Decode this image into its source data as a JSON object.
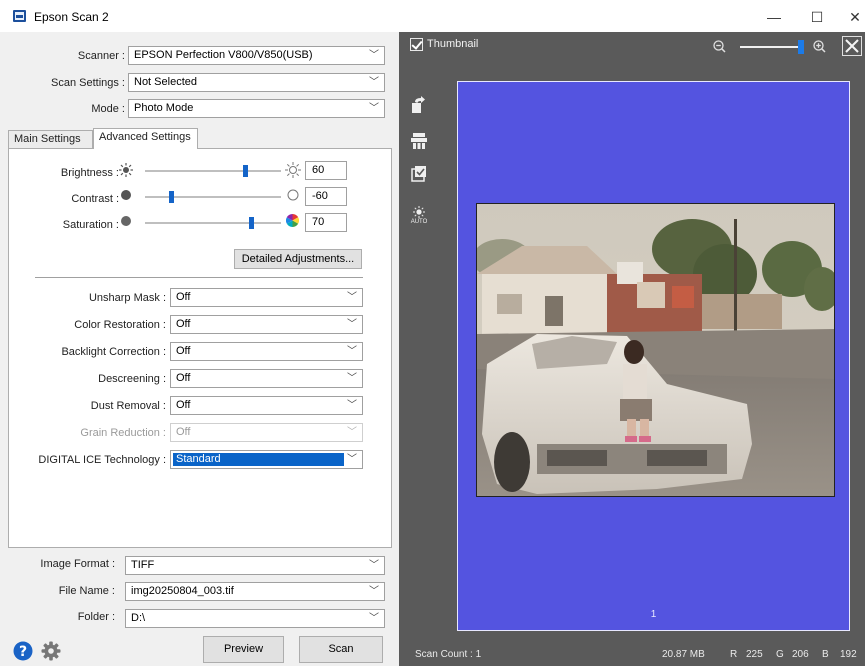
{
  "window": {
    "title": "Epson Scan 2",
    "minimize": "—",
    "maximize": "☐",
    "close": "✕"
  },
  "scanner": {
    "label": "Scanner :",
    "value": "EPSON Perfection V800/V850(USB)"
  },
  "scan_settings": {
    "label": "Scan Settings :",
    "value": "Not Selected"
  },
  "mode": {
    "label": "Mode :",
    "value": "Photo Mode"
  },
  "tabs": [
    {
      "label": "Main Settings"
    },
    {
      "label": "Advanced Settings"
    }
  ],
  "adjustments": {
    "brightness": {
      "label": "Brightness :",
      "value": "60"
    },
    "contrast": {
      "label": "Contrast :",
      "value": "-60"
    },
    "saturation": {
      "label": "Saturation :",
      "value": "70"
    },
    "detailed_button": "Detailed Adjustments..."
  },
  "advanced": {
    "unsharp_mask": {
      "label": "Unsharp Mask :",
      "value": "Off"
    },
    "color_restoration": {
      "label": "Color Restoration :",
      "value": "Off"
    },
    "backlight_correction": {
      "label": "Backlight Correction :",
      "value": "Off"
    },
    "descreening": {
      "label": "Descreening :",
      "value": "Off"
    },
    "dust_removal": {
      "label": "Dust Removal :",
      "value": "Off"
    },
    "grain_reduction": {
      "label": "Grain Reduction :",
      "value": "Off"
    },
    "digital_ice": {
      "label": "DIGITAL ICE Technology :",
      "value": "Standard"
    }
  },
  "output": {
    "image_format": {
      "label": "Image Format :",
      "value": "TIFF"
    },
    "file_name": {
      "label": "File Name :",
      "value": "img20250804_003.tif"
    },
    "folder": {
      "label": "Folder :",
      "value": "D:\\"
    }
  },
  "buttons": {
    "preview": "Preview",
    "scan": "Scan"
  },
  "preview": {
    "thumbnail_label": "Thumbnail",
    "thumbnail_checked": true,
    "page_number": "1",
    "auto_label": "AUTO"
  },
  "status": {
    "scan_count": "Scan Count : 1",
    "file_size": "20.87 MB",
    "r_label": "R",
    "r_value": "225",
    "g_label": "G",
    "g_value": "206",
    "b_label": "B",
    "b_value": "192"
  },
  "colors": {
    "accent": "#1464c8",
    "preview_background": "#5454e0",
    "panel_dark": "#5a5a5a"
  }
}
